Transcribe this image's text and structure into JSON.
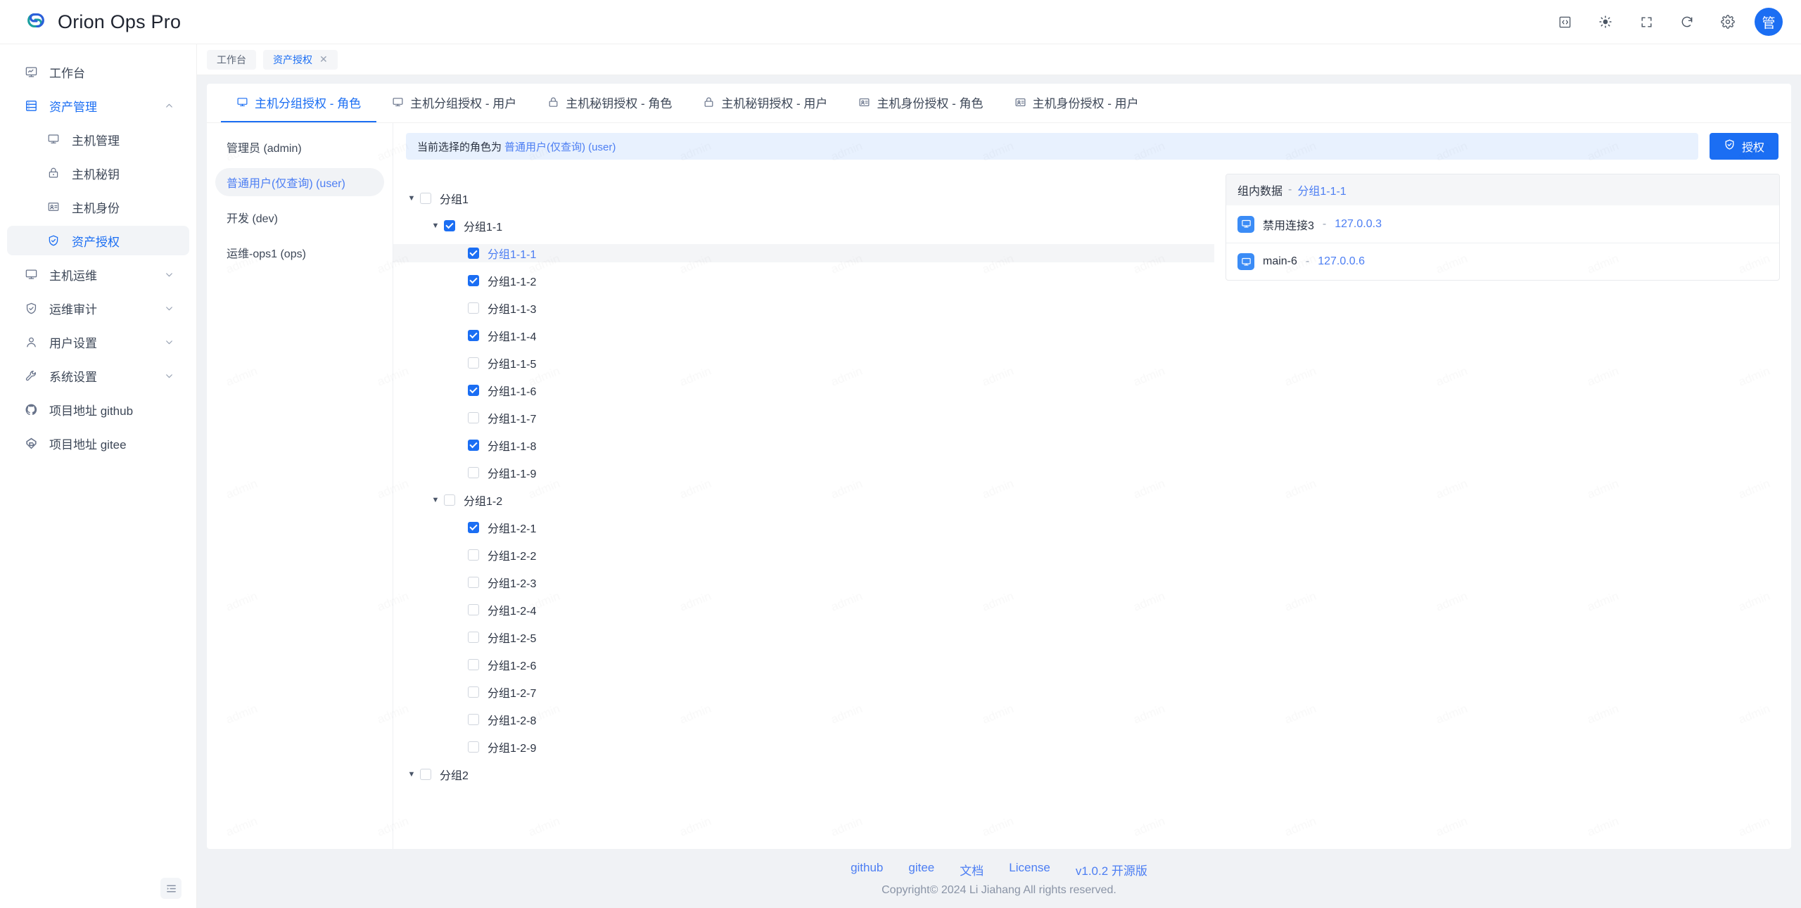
{
  "header": {
    "brand_title": "Orion Ops Pro",
    "logo_icon": "orion-logo-icon",
    "actions": [
      {
        "name": "code-icon",
        "glyph": "code"
      },
      {
        "name": "theme-sun-icon",
        "glyph": "sun"
      },
      {
        "name": "fullscreen-icon",
        "glyph": "fullscreen"
      },
      {
        "name": "refresh-icon",
        "glyph": "refresh"
      },
      {
        "name": "gear-icon",
        "glyph": "gear"
      }
    ],
    "avatar_text": "管"
  },
  "sidebar": {
    "items": [
      {
        "label": "工作台",
        "icon": "dashboard-icon",
        "type": "item"
      },
      {
        "label": "资产管理",
        "icon": "database-icon",
        "type": "group",
        "expanded": true,
        "active": true
      },
      {
        "label": "主机管理",
        "icon": "monitor-icon",
        "type": "sub"
      },
      {
        "label": "主机秘钥",
        "icon": "lock-icon",
        "type": "sub"
      },
      {
        "label": "主机身份",
        "icon": "id-card-icon",
        "type": "sub"
      },
      {
        "label": "资产授权",
        "icon": "shield-check-icon",
        "type": "sub",
        "active": true
      },
      {
        "label": "主机运维",
        "icon": "monitor-icon",
        "type": "group",
        "expanded": false
      },
      {
        "label": "运维审计",
        "icon": "shield-icon",
        "type": "group",
        "expanded": false
      },
      {
        "label": "用户设置",
        "icon": "user-icon",
        "type": "group",
        "expanded": false
      },
      {
        "label": "系统设置",
        "icon": "wrench-icon",
        "type": "group",
        "expanded": false
      },
      {
        "label": "项目地址 github",
        "icon": "github-icon",
        "type": "item"
      },
      {
        "label": "项目地址 gitee",
        "icon": "gitee-icon",
        "type": "item"
      }
    ],
    "collapse_icon": "menu-fold-icon"
  },
  "page_tabs": [
    {
      "label": "工作台",
      "closable": false,
      "active": false
    },
    {
      "label": "资产授权",
      "closable": true,
      "active": true,
      "close_glyph": "✕"
    }
  ],
  "content_tabs": [
    {
      "label": "主机分组授权 - 角色",
      "icon": "monitor-icon",
      "active": true
    },
    {
      "label": "主机分组授权 - 用户",
      "icon": "monitor-icon",
      "active": false
    },
    {
      "label": "主机秘钥授权 - 角色",
      "icon": "lock-icon",
      "active": false
    },
    {
      "label": "主机秘钥授权 - 用户",
      "icon": "lock-icon",
      "active": false
    },
    {
      "label": "主机身份授权 - 角色",
      "icon": "id-card-icon",
      "active": false
    },
    {
      "label": "主机身份授权 - 用户",
      "icon": "id-card-icon",
      "active": false
    }
  ],
  "roles": [
    {
      "label": "管理员 (admin)",
      "active": false
    },
    {
      "label": "普通用户(仅查询) (user)",
      "active": true
    },
    {
      "label": "开发 (dev)",
      "active": false
    },
    {
      "label": "运维-ops1 (ops)",
      "active": false
    }
  ],
  "toolbar": {
    "alert_prefix": "当前选择的角色为",
    "alert_role": "普通用户(仅查询) (user)",
    "authorize_label": "授权",
    "authorize_icon": "shield-check-icon"
  },
  "tree": [
    {
      "label": "分组1",
      "depth": 0,
      "checked": false,
      "expanded": true,
      "selected": false
    },
    {
      "label": "分组1-1",
      "depth": 1,
      "checked": true,
      "expanded": true,
      "selected": false
    },
    {
      "label": "分组1-1-1",
      "depth": 2,
      "checked": true,
      "expanded": null,
      "selected": true
    },
    {
      "label": "分组1-1-2",
      "depth": 2,
      "checked": true,
      "expanded": null,
      "selected": false
    },
    {
      "label": "分组1-1-3",
      "depth": 2,
      "checked": false,
      "expanded": null,
      "selected": false
    },
    {
      "label": "分组1-1-4",
      "depth": 2,
      "checked": true,
      "expanded": null,
      "selected": false
    },
    {
      "label": "分组1-1-5",
      "depth": 2,
      "checked": false,
      "expanded": null,
      "selected": false
    },
    {
      "label": "分组1-1-6",
      "depth": 2,
      "checked": true,
      "expanded": null,
      "selected": false
    },
    {
      "label": "分组1-1-7",
      "depth": 2,
      "checked": false,
      "expanded": null,
      "selected": false
    },
    {
      "label": "分组1-1-8",
      "depth": 2,
      "checked": true,
      "expanded": null,
      "selected": false
    },
    {
      "label": "分组1-1-9",
      "depth": 2,
      "checked": false,
      "expanded": null,
      "selected": false
    },
    {
      "label": "分组1-2",
      "depth": 1,
      "checked": false,
      "expanded": true,
      "selected": false
    },
    {
      "label": "分组1-2-1",
      "depth": 2,
      "checked": true,
      "expanded": null,
      "selected": false
    },
    {
      "label": "分组1-2-2",
      "depth": 2,
      "checked": false,
      "expanded": null,
      "selected": false
    },
    {
      "label": "分组1-2-3",
      "depth": 2,
      "checked": false,
      "expanded": null,
      "selected": false
    },
    {
      "label": "分组1-2-4",
      "depth": 2,
      "checked": false,
      "expanded": null,
      "selected": false
    },
    {
      "label": "分组1-2-5",
      "depth": 2,
      "checked": false,
      "expanded": null,
      "selected": false
    },
    {
      "label": "分组1-2-6",
      "depth": 2,
      "checked": false,
      "expanded": null,
      "selected": false
    },
    {
      "label": "分组1-2-7",
      "depth": 2,
      "checked": false,
      "expanded": null,
      "selected": false
    },
    {
      "label": "分组1-2-8",
      "depth": 2,
      "checked": false,
      "expanded": null,
      "selected": false
    },
    {
      "label": "分组1-2-9",
      "depth": 2,
      "checked": false,
      "expanded": null,
      "selected": false
    },
    {
      "label": "分组2",
      "depth": 0,
      "checked": false,
      "expanded": true,
      "selected": false
    }
  ],
  "group_data": {
    "title": "组内数据",
    "separator": "-",
    "group_name": "分组1-1-1",
    "rows": [
      {
        "name": "禁用连接3",
        "sep": "-",
        "address": "127.0.0.3",
        "icon": "host-icon"
      },
      {
        "name": "main-6",
        "sep": "-",
        "address": "127.0.0.6",
        "icon": "host-icon"
      }
    ]
  },
  "footer": {
    "links": [
      "github",
      "gitee",
      "文档",
      "License",
      "v1.0.2 开源版"
    ],
    "copyright": "Copyright© 2024 Li Jiahang All rights reserved."
  },
  "watermark": {
    "text": "admin"
  },
  "colors": {
    "primary": "#1b6ef3",
    "link": "#4c7ef3",
    "alert_bg": "#e8f1fe",
    "page_bg": "#f0f2f5",
    "text": "#2b3342"
  }
}
